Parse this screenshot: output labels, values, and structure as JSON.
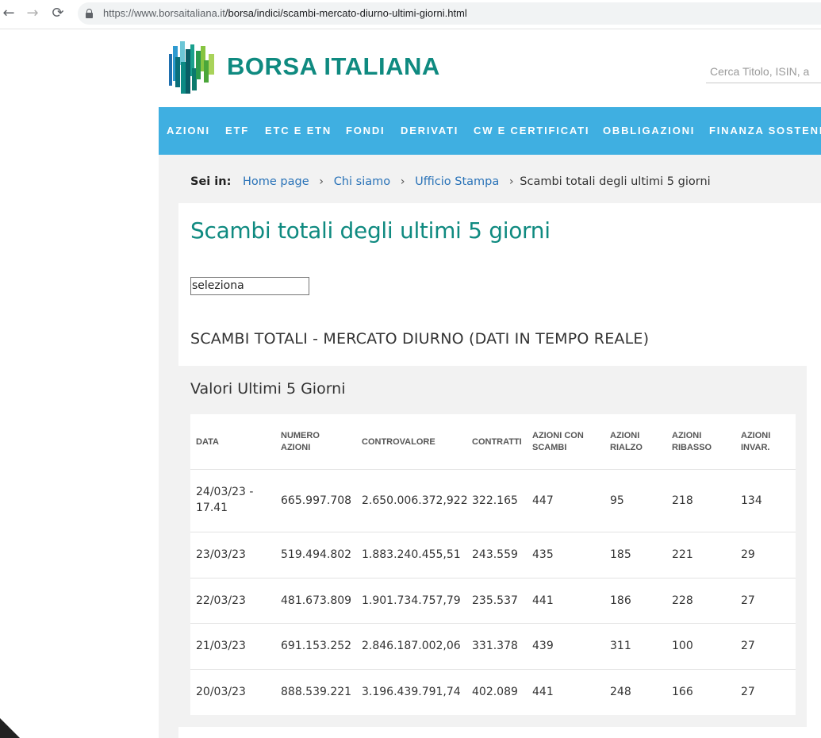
{
  "browser": {
    "url_host": "https://www.borsaitaliana.it",
    "url_path": "/borsa/indici/scambi-mercato-diurno-ultimi-giorni.html"
  },
  "header": {
    "logo_text": "BORSA ITALIANA",
    "search_placeholder": "Cerca Titolo, ISIN, a"
  },
  "nav": {
    "items": [
      "AZIONI",
      "ETF",
      "ETC E ETN",
      "FONDI",
      "DERIVATI",
      "CW E CERTIFICATI",
      "OBBLIGAZIONI",
      "FINANZA SOSTENI"
    ]
  },
  "breadcrumb": {
    "label": "Sei in:",
    "links": [
      "Home page",
      "Chi siamo",
      "Ufficio Stampa"
    ],
    "current": "Scambi totali degli ultimi 5 giorni",
    "sep": "›"
  },
  "page": {
    "title": "Scambi totali degli ultimi 5 giorni",
    "select_value": "seleziona",
    "section_heading": "SCAMBI TOTALI - MERCATO DIURNO (DATI IN TEMPO REALE)",
    "card_heading": "Valori Ultimi 5 Giorni"
  },
  "table": {
    "columns": [
      "DATA",
      "NUMERO AZIONI",
      "CONTROVALORE",
      "CONTRATTI",
      "AZIONI CON SCAMBI",
      "AZIONI RIALZO",
      "AZIONI RIBASSO",
      "AZIONI INVAR."
    ],
    "rows": [
      [
        "24/03/23 - 17.41",
        "665.997.708",
        "2.650.006.372,922",
        "322.165",
        "447",
        "95",
        "218",
        "134"
      ],
      [
        "23/03/23",
        "519.494.802",
        "1.883.240.455,51",
        "243.559",
        "435",
        "185",
        "221",
        "29"
      ],
      [
        "22/03/23",
        "481.673.809",
        "1.901.734.757,79",
        "235.537",
        "441",
        "186",
        "228",
        "27"
      ],
      [
        "21/03/23",
        "691.153.252",
        "2.846.187.002,06",
        "331.378",
        "439",
        "311",
        "100",
        "27"
      ],
      [
        "20/03/23",
        "888.539.221",
        "3.196.439.791,74",
        "402.089",
        "441",
        "248",
        "166",
        "27"
      ]
    ]
  }
}
